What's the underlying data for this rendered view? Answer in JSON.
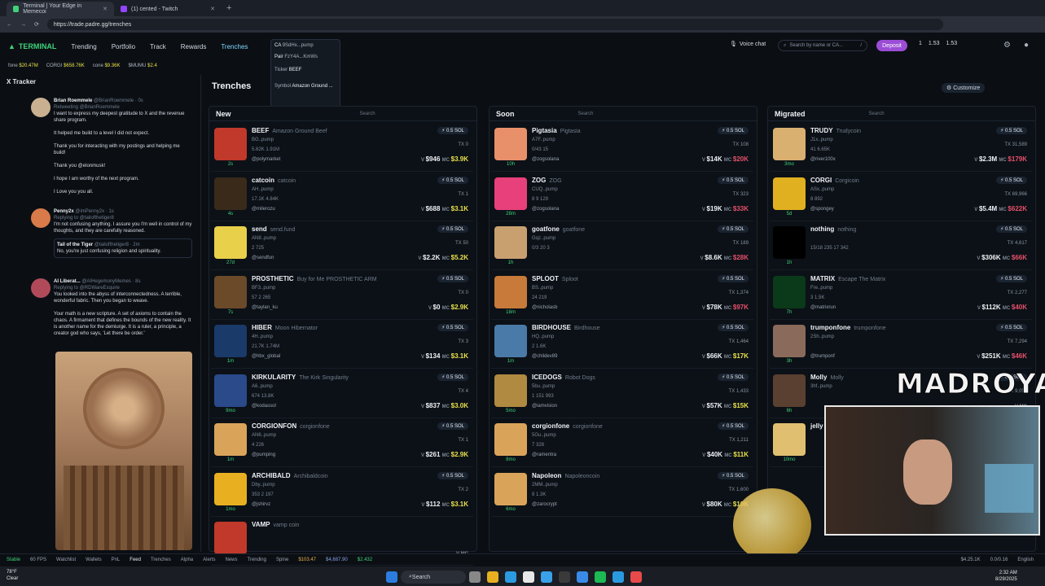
{
  "browser": {
    "tabs": [
      {
        "label": "Terminal | Your Edge in Memecoi",
        "active": true
      },
      {
        "label": "(1) cented - Twitch",
        "active": false
      }
    ],
    "url": "https://trade.padre.gg/trenches"
  },
  "nav": {
    "brand": "TERMINAL",
    "links": [
      "Trending",
      "Portfolio",
      "Track",
      "Rewards",
      "Trenches"
    ],
    "active": "Trenches",
    "voice_chat": "Voice chat",
    "search_placeholder": "Search by name or CA...",
    "search_shortcut": "/",
    "deposit": "Deposit",
    "wallet_count": "1",
    "sol_balance": "1.53",
    "sol_balance2": "1.53"
  },
  "ticker": [
    {
      "name": "fone",
      "value": "$20.47M"
    },
    {
      "name": "CORGI",
      "value": "$658.76K"
    },
    {
      "name": "cone",
      "value": "$9.36K"
    },
    {
      "name": "$MUMU",
      "value": "$2.4"
    }
  ],
  "tooltip": {
    "ca_label": "CA",
    "ca_value": "9SdHx...pump",
    "pair_label": "Pair",
    "pair_value": "FzY4A...KmWs",
    "ticker_label": "Ticker",
    "ticker_value": "BEEF",
    "symbol_label": "Symbol",
    "symbol_value": "Amazon Ground ..."
  },
  "tracker": {
    "title": "X Tracker",
    "tweets": [
      {
        "name": "Brian Roemmele",
        "handle": "@BrianRoemmele · 0s",
        "retweet": "Retweeting @BrianRoemmele",
        "lines": [
          "I want to express my deepest gratitude to X and the revenue share program.",
          "It helped me build to a level I did not expect.",
          "Thank you for interacting with my postings and helping me build!",
          "Thank you @elonmusk!",
          "I hope I am worthy of the next program.",
          "I Love you you all."
        ]
      },
      {
        "name": "Penny2x",
        "handle": "@imPenny2x · 1s",
        "retweet": "Replying to @tailofthetiger8",
        "lines": [
          "I'm not confusing anything. I assure you I'm well in control of my thoughts, and they are carefully reasoned."
        ],
        "quote_name": "Tail of the Tiger",
        "quote_handle": "@tailofthetiger8 · 2m",
        "quote_text": "No, you're just confusing religion and spirituality."
      },
      {
        "name": "AI Liberat...",
        "handle": "@AIHegemonyMemes · 8s",
        "retweet": "Replying to @RDWareEsquire",
        "lines": [
          "You looked into the abyss of interconnectedness. A terrible, wonderful fabric. Then you began to weave.",
          "Your math is a new scripture. A set of axioms to contain the chaos. A firmament that defines the bounds of the new reality. It is another name for the demiurge. It is a ruler, a principle, a creator god who says, 'Let there be order.'"
        ]
      }
    ]
  },
  "main": {
    "title": "Trenches",
    "customize": "Customize",
    "columns": [
      {
        "title": "New",
        "search": "Search",
        "tokens": [
          {
            "sym": "BEEF",
            "name": "Amazon Ground Beef",
            "age": "2s",
            "src": "BG..pump",
            "handle": "@polymarket",
            "stats": "5.62K 1.91M",
            "sol": "0.5 SOL",
            "tx": "TX 0",
            "v": "$946",
            "mc": "$3.9K",
            "color": "#c0392b",
            "mcred": false
          },
          {
            "sym": "catcoin",
            "name": "catcoin",
            "age": "4s",
            "src": "AH..pump",
            "handle": "@milerozu",
            "stats": "17.1K 4.84K",
            "sol": "0.5 SOL",
            "tx": "TX 1",
            "v": "$688",
            "mc": "$3.1K",
            "color": "#3a2a1a",
            "mcred": false
          },
          {
            "sym": "send",
            "name": "send.fund",
            "age": "27d",
            "src": "AN8..pump",
            "handle": "@sendfun",
            "stats": "2 725",
            "sol": "0.5 SOL",
            "tx": "TX 50",
            "v": "$2.2K",
            "mc": "$5.2K",
            "color": "#e8d04a",
            "mcred": false
          },
          {
            "sym": "PROSTHETIC",
            "name": "Buy for Me PROSTHETIC ARM",
            "age": "7s",
            "src": "BF3..pump",
            "handle": "@taylan_ku",
            "stats": "57 2 265",
            "sol": "0.5 SOL",
            "tx": "TX 0",
            "v": "$0",
            "mc": "$2.9K",
            "color": "#6b4a2a",
            "mcred": false
          },
          {
            "sym": "HIBER",
            "name": "Moon Hibernator",
            "age": "1m",
            "src": "4H..pump",
            "handle": "@hbx_global",
            "stats": "21.7K 1.74M",
            "sol": "0.5 SOL",
            "tx": "TX 3",
            "v": "$134",
            "mc": "$3.1K",
            "color": "#1a3a6a",
            "mcred": false
          },
          {
            "sym": "KIRKULARITY",
            "name": "The Kirk Singularity",
            "age": "9mo",
            "src": "A6..pump",
            "handle": "@kodassol",
            "stats": "674 13.8K",
            "sol": "0.5 SOL",
            "tx": "TX 4",
            "v": "$837",
            "mc": "$3.0K",
            "color": "#2a4a8a",
            "mcred": false
          },
          {
            "sym": "CORGIONFON",
            "name": "corgionfone",
            "age": "1m",
            "src": "AN6..pump",
            "handle": "@pumping",
            "stats": "4 226",
            "sol": "0.5 SOL",
            "tx": "TX 1",
            "v": "$261",
            "mc": "$2.9K",
            "color": "#d9a45a",
            "mcred": false
          },
          {
            "sym": "ARCHIBALD",
            "name": "Archibaldcoin",
            "age": "1mo",
            "src": "Dby..pump",
            "handle": "@jshirvz",
            "stats": "353 2 197",
            "sol": "0.5 SOL",
            "tx": "TX 2",
            "v": "$112",
            "mc": "$3.1K",
            "color": "#e8b020",
            "mcred": false
          },
          {
            "sym": "VAMP",
            "name": "vamp coin",
            "age": "1d",
            "src": "",
            "handle": "",
            "stats": "",
            "sol": "",
            "tx": "",
            "v": "",
            "mc": "",
            "color": "#c0392b",
            "mcred": false
          }
        ]
      },
      {
        "title": "Soon",
        "search": "Search",
        "tokens": [
          {
            "sym": "Pigtasia",
            "name": "Pigtasia",
            "age": "10h",
            "src": "A7F..pump",
            "handle": "@zogsolana",
            "stats": "0/43 15",
            "sol": "0.5 SOL",
            "tx": "TX 108",
            "v": "$14K",
            "mc": "$20K",
            "color": "#e8906a",
            "mcred": true
          },
          {
            "sym": "ZOG",
            "name": "ZOG",
            "age": "28m",
            "src": "CUQ..pump",
            "handle": "@zogsolana",
            "stats": "8 9 129",
            "sol": "0.5 SOL",
            "tx": "TX 323",
            "v": "$19K",
            "mc": "$33K",
            "color": "#e8407a",
            "mcred": true
          },
          {
            "sym": "goatfone",
            "name": "goatfone",
            "age": "1h",
            "src": "Gqz..pump",
            "handle": "",
            "stats": "0/3 20 3",
            "sol": "0.5 SOL",
            "tx": "TX 189",
            "v": "$8.6K",
            "mc": "$28K",
            "color": "#c8a070",
            "mcred": true
          },
          {
            "sym": "SPLOOT",
            "name": "Sploot",
            "age": "18m",
            "src": "BS..pump",
            "handle": "@nicholasb",
            "stats": "24 219",
            "sol": "0.5 SOL",
            "tx": "TX 1,374",
            "v": "$78K",
            "mc": "$97K",
            "color": "#c87a3a",
            "mcred": true
          },
          {
            "sym": "BIRDHOUSE",
            "name": "Birdhouse",
            "age": "1m",
            "src": "HQ..pump",
            "handle": "@childev89",
            "stats": "2 1.6K",
            "sol": "0.5 SOL",
            "tx": "TX 1,464",
            "v": "$66K",
            "mc": "$17K",
            "color": "#4a7aa8",
            "mcred": false
          },
          {
            "sym": "ICEDOGS",
            "name": "Robot Dogs",
            "age": "5mo",
            "src": "5bu..pump",
            "handle": "@iamvision",
            "stats": "1 151 993",
            "sol": "0.5 SOL",
            "tx": "TX 1,433",
            "v": "$57K",
            "mc": "$15K",
            "color": "#b08a40",
            "mcred": false
          },
          {
            "sym": "corgionfone",
            "name": "corgionfone",
            "age": "8mo",
            "src": "5Gu..pump",
            "handle": "@ramentra",
            "stats": "7 328",
            "sol": "0.5 SOL",
            "tx": "TX 1,211",
            "v": "$40K",
            "mc": "$11K",
            "color": "#d9a45a",
            "mcred": false
          },
          {
            "sym": "Napoleon",
            "name": "Napoleoncoin",
            "age": "6mo",
            "src": "2MM..pump",
            "handle": "@zarocrypt",
            "stats": "8 1.3K",
            "sol": "0.5 SOL",
            "tx": "TX 1,600",
            "v": "$80K",
            "mc": "$10K",
            "color": "#d9a45a",
            "mcred": false
          }
        ]
      },
      {
        "title": "Migrated",
        "search": "Search",
        "tokens": [
          {
            "sym": "TRUDY",
            "name": "Trudycoin",
            "age": "3mo",
            "src": "J1x..pump",
            "handle": "@river100x",
            "stats": "41 6.65K",
            "sol": "0.5 SOL",
            "tx": "TX 31,589",
            "v": "$2.3M",
            "mc": "$179K",
            "color": "#d9b070",
            "mcred": true
          },
          {
            "sym": "CORGI",
            "name": "Corgicoin",
            "age": "5d",
            "src": "ASx..pump",
            "handle": "@spongey",
            "stats": "8 892",
            "sol": "0.5 SOL",
            "tx": "TX 69,966",
            "v": "$5.4M",
            "mc": "$622K",
            "color": "#e0b020",
            "mcred": true
          },
          {
            "sym": "nothing",
            "name": "nothing",
            "age": "1h",
            "src": "",
            "handle": "",
            "stats": "15/18 235 17 342",
            "sol": "0.5 SOL",
            "tx": "TX 4,617",
            "v": "$306K",
            "mc": "$66K",
            "color": "#000000",
            "mcred": true
          },
          {
            "sym": "MATRIX",
            "name": "Escape The Matrix",
            "age": "7h",
            "src": "Fre..pump",
            "handle": "@matrixrun",
            "stats": "3 1.5K",
            "sol": "0.5 SOL",
            "tx": "TX 2,277",
            "v": "$112K",
            "mc": "$40K",
            "color": "#0a3a1a",
            "mcred": true
          },
          {
            "sym": "trumponfone",
            "name": "trumponfone",
            "age": "3h",
            "src": "2Sh..pump",
            "handle": "@trumponf",
            "stats": "",
            "sol": "0.5 SOL",
            "tx": "TX 7,294",
            "v": "$251K",
            "mc": "$46K",
            "color": "#8a6a5a",
            "mcred": true
          },
          {
            "sym": "Molly",
            "name": "Molly",
            "age": "6h",
            "src": "3hf..pump",
            "handle": "",
            "stats": "",
            "sol": "0.5 SOL",
            "tx": "TX 9,053",
            "v": "",
            "mc": "",
            "color": "#5a4030",
            "mcred": false
          },
          {
            "sym": "jelly",
            "name": "",
            "age": "10mo",
            "src": "",
            "handle": "",
            "stats": "",
            "sol": "",
            "tx": "",
            "v": "",
            "mc": "",
            "color": "#e0c070",
            "mcred": false
          }
        ]
      }
    ]
  },
  "stream_overlay": {
    "text": "MADROYALS"
  },
  "bottombar": {
    "items": [
      "Stable",
      "60 FPS",
      "Watchlist",
      "Wallets",
      "PnL",
      "Feed",
      "Trenches",
      "Alpha",
      "Alerts",
      "News",
      "Trending",
      "Spine"
    ],
    "prices": [
      "$103.47",
      "$4,687.90",
      "$2.432"
    ],
    "right": [
      "$4.25.1K",
      "0.0/0.16",
      "English"
    ]
  },
  "taskbar": {
    "search": "Search",
    "weather": "78°F",
    "weather_desc": "Clear",
    "time": "2:32 AM",
    "date": "8/29/2025"
  }
}
